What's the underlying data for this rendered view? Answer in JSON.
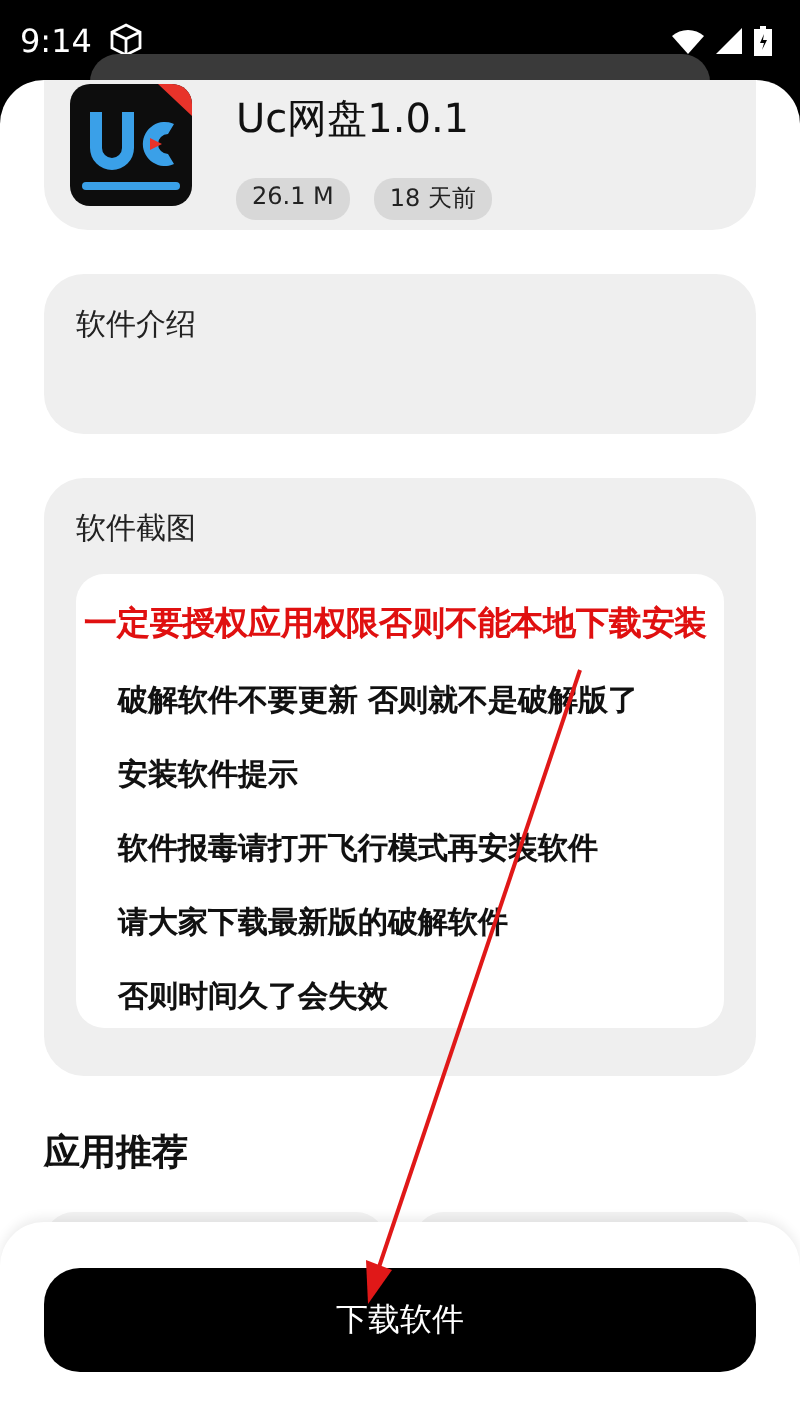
{
  "status_bar": {
    "time": "9:14"
  },
  "app": {
    "title": "Uc网盘1.0.1",
    "tags": [
      "26.1 M",
      "18 天前"
    ]
  },
  "intro": {
    "heading": "软件介绍"
  },
  "screenshots": {
    "heading": "软件截图",
    "lines": [
      {
        "text": "一定要授权应用权限否则不能本地下载安装",
        "kind": "warning"
      },
      {
        "text": "破解软件不要更新 否则就不是破解版了",
        "kind": "normal"
      },
      {
        "text": "安装软件提示",
        "kind": "normal"
      },
      {
        "text": "软件报毒请打开飞行模式再安装软件",
        "kind": "normal"
      },
      {
        "text": "请大家下载最新版的破解软件",
        "kind": "normal"
      },
      {
        "text": "否则时间久了会失效",
        "kind": "normal"
      }
    ]
  },
  "recommend": {
    "heading": "应用推荐"
  },
  "download_button": "下载软件"
}
